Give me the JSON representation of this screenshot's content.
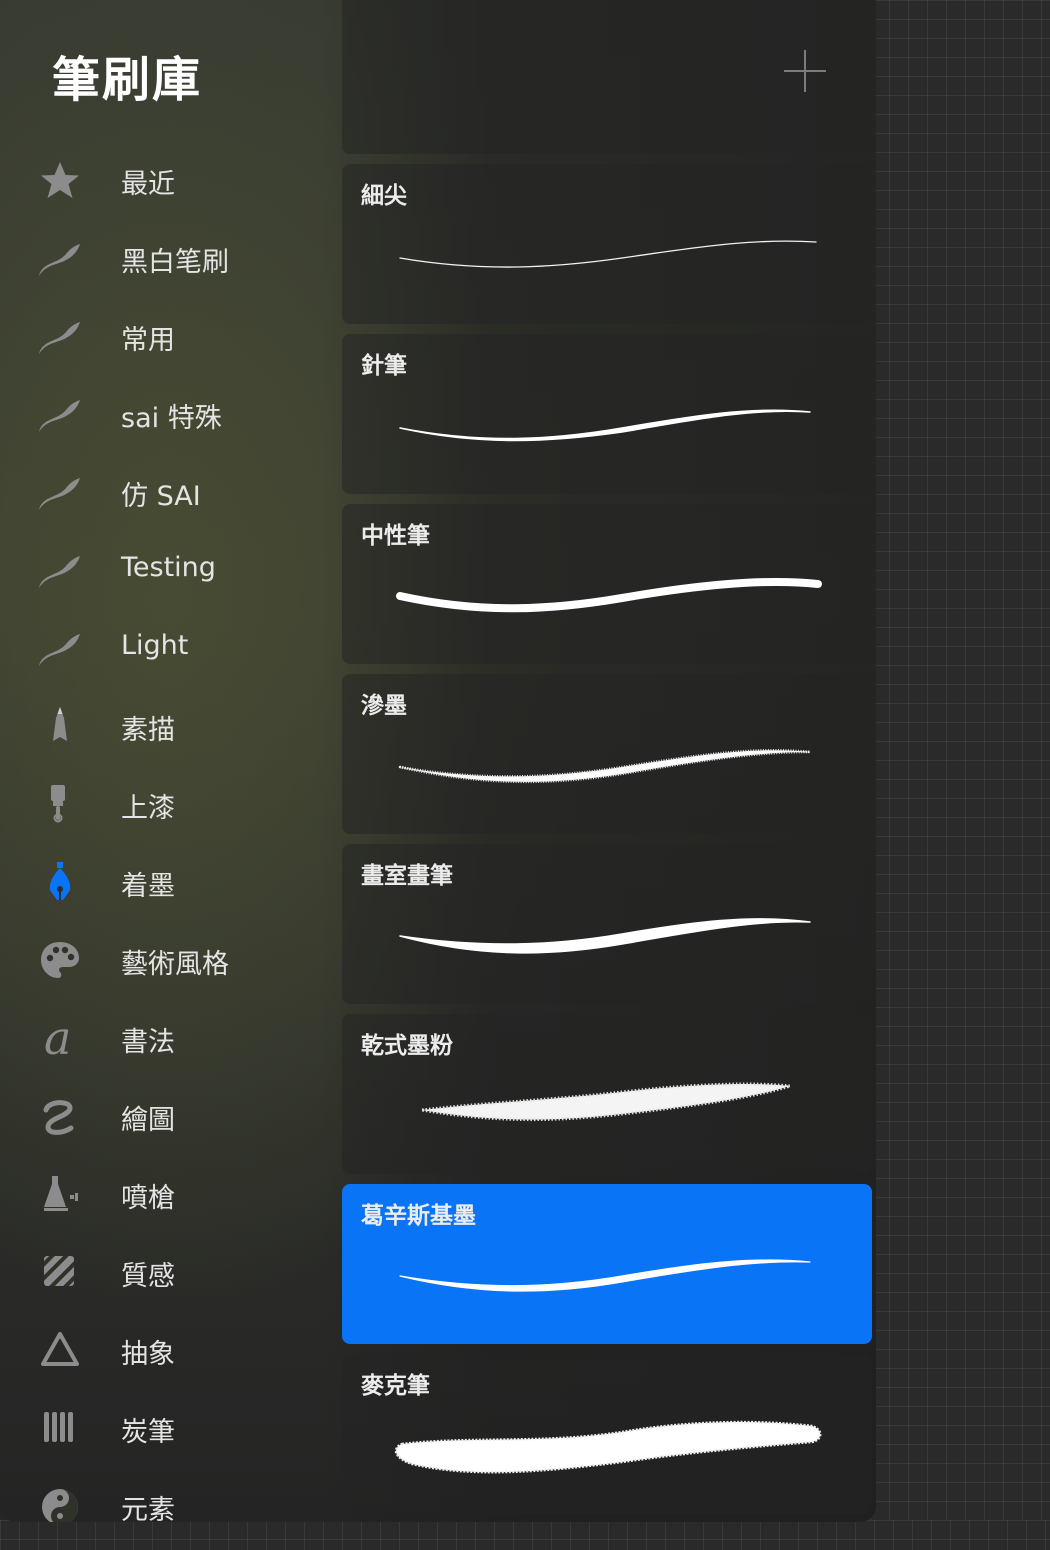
{
  "header": {
    "title": "筆刷庫",
    "add_label": "+"
  },
  "sidebar": {
    "items": [
      {
        "label": "最近",
        "icon": "star-icon"
      },
      {
        "label": "黑白笔刷",
        "icon": "brush-stroke-icon"
      },
      {
        "label": "常用",
        "icon": "brush-stroke-icon"
      },
      {
        "label": "sai 特殊",
        "icon": "brush-stroke-icon"
      },
      {
        "label": "仿 SAI",
        "icon": "brush-stroke-icon"
      },
      {
        "label": "Testing",
        "icon": "brush-stroke-icon"
      },
      {
        "label": "Light",
        "icon": "brush-stroke-icon"
      },
      {
        "label": "素描",
        "icon": "pencil-tip-icon"
      },
      {
        "label": "上漆",
        "icon": "paint-brush-icon"
      },
      {
        "label": "着墨",
        "icon": "pen-nib-icon",
        "active": true,
        "color": "#0a74f6"
      },
      {
        "label": "藝術風格",
        "icon": "palette-icon"
      },
      {
        "label": "書法",
        "icon": "calligraphy-a-icon"
      },
      {
        "label": "繪圖",
        "icon": "squiggle-icon"
      },
      {
        "label": "噴槍",
        "icon": "airbrush-icon"
      },
      {
        "label": "質感",
        "icon": "texture-hatch-icon"
      },
      {
        "label": "抽象",
        "icon": "triangle-icon"
      },
      {
        "label": "炭筆",
        "icon": "charcoal-bars-icon"
      },
      {
        "label": "元素",
        "icon": "yin-yang-icon"
      }
    ]
  },
  "brushes": [
    {
      "name": "細尖",
      "stroke": "hairline"
    },
    {
      "name": "針筆",
      "stroke": "thin-taper"
    },
    {
      "name": "中性筆",
      "stroke": "medium-round"
    },
    {
      "name": "滲墨",
      "stroke": "bleed-ink"
    },
    {
      "name": "畫室畫筆",
      "stroke": "studio-taper"
    },
    {
      "name": "乾式墨粉",
      "stroke": "dry-toner"
    },
    {
      "name": "葛辛斯基墨",
      "stroke": "gesinski-ink",
      "selected": true
    },
    {
      "name": "麥克筆",
      "stroke": "marker"
    }
  ],
  "colors": {
    "accent": "#0a74f6",
    "text": "#e4e4e4",
    "icon": "#8c8c8c"
  }
}
